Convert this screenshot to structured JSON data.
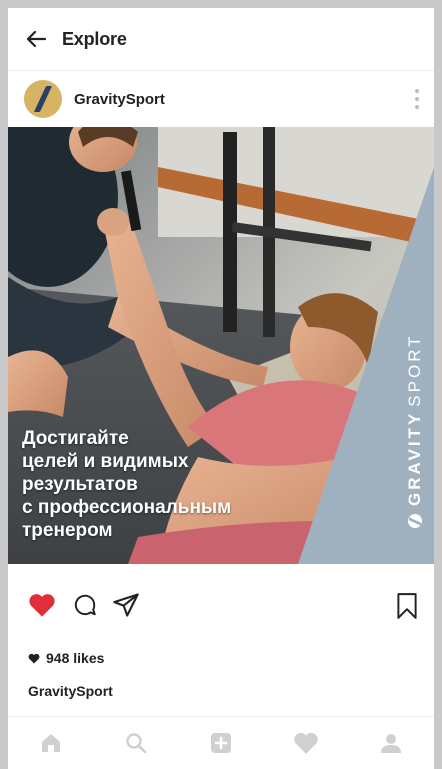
{
  "header": {
    "title": "Explore"
  },
  "post": {
    "username": "GravitySport",
    "caption_lines": [
      "Достигайте",
      "целей и видимых",
      "результатов",
      "с профессиональным",
      "тренером"
    ],
    "brand_bold": "GRAVITY",
    "brand_light": "SPORT",
    "likes": "948 likes",
    "owner": "GravitySport"
  },
  "colors": {
    "like_heart": "#e02e3a",
    "brand_band": "#9fb0bf",
    "avatar_bg": "#d7b464",
    "avatar_slash": "#2d3f66"
  },
  "icons": {
    "back": "arrow-left-icon",
    "more": "more-vertical-icon",
    "like": "heart-filled-icon",
    "comment": "comment-icon",
    "share": "paper-plane-icon",
    "save": "bookmark-icon",
    "nav": [
      "home-icon",
      "search-icon",
      "add-icon",
      "activity-heart-icon",
      "profile-icon"
    ]
  }
}
